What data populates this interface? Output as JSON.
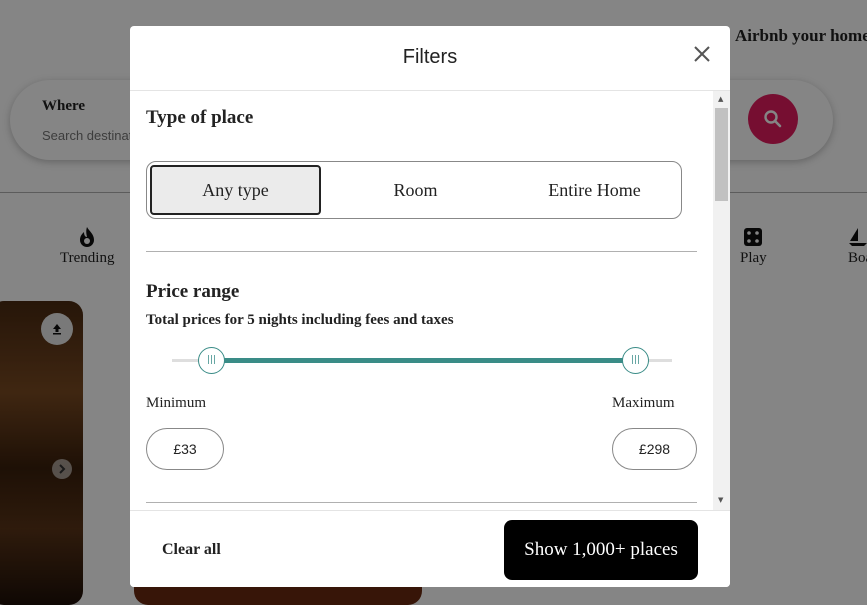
{
  "background": {
    "host_link": "Airbnb your home",
    "search": {
      "where_label": "Where",
      "placeholder": "Search destinations"
    },
    "categories": [
      {
        "label": "Trending",
        "icon": "flame-icon"
      },
      {
        "label": "Play",
        "icon": "dice-icon"
      },
      {
        "label": "Boats",
        "icon": "sailboat-icon"
      }
    ]
  },
  "modal": {
    "title": "Filters",
    "type_of_place": {
      "title": "Type of place",
      "options": [
        "Any type",
        "Room",
        "Entire Home"
      ],
      "selected": "Any type"
    },
    "price_range": {
      "title": "Price range",
      "subtitle": "Total prices for 5 nights including fees and taxes",
      "min_label": "Minimum",
      "max_label": "Maximum",
      "min_value": "£33",
      "max_value": "£298"
    },
    "footer": {
      "clear_label": "Clear all",
      "show_label": "Show 1,000+ places"
    }
  },
  "colors": {
    "accent": "#3a8c87",
    "search_button": "#e31c5f",
    "primary_button": "#000000"
  }
}
